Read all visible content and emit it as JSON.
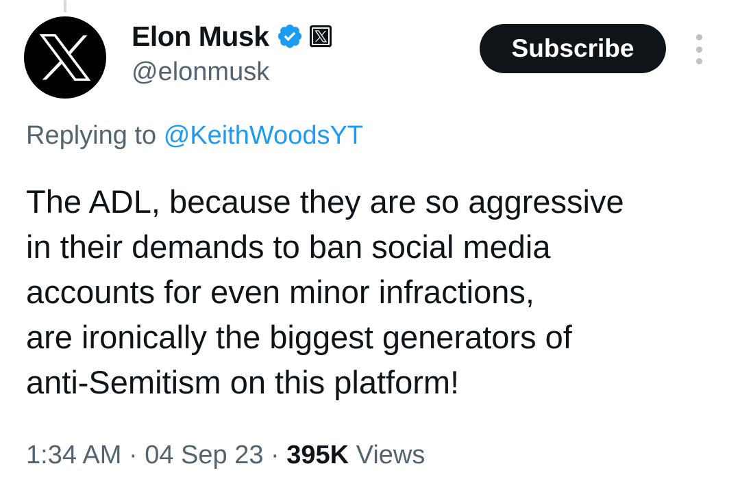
{
  "tweet": {
    "author": {
      "display_name": "Elon Musk",
      "handle": "@elonmusk",
      "avatar_icon": "x-logo-icon",
      "verified_icon": "verified-badge-icon",
      "affiliate_icon": "x-affiliate-badge-icon"
    },
    "subscribe_label": "Subscribe",
    "more_icon": "more-vertical-icon",
    "replying_to": {
      "prefix": "Replying to",
      "handle": "@KeithWoodsYT"
    },
    "text_lines": [
      "The ADL, because they are so aggressive",
      "in their demands to ban social media",
      "accounts for even minor infractions,",
      "are ironically the biggest generators of",
      "anti-Semitism on this platform!"
    ],
    "meta": {
      "time": "1:34 AM",
      "separator": "·",
      "date": "04 Sep 23",
      "views_count": "395K",
      "views_label": "Views"
    }
  },
  "colors": {
    "text_primary": "#0f1419",
    "text_secondary": "#536471",
    "link": "#1d9bf0",
    "verified": "#1d9bf0",
    "button_bg": "#0f1419",
    "thread_line": "#cfd9de"
  }
}
